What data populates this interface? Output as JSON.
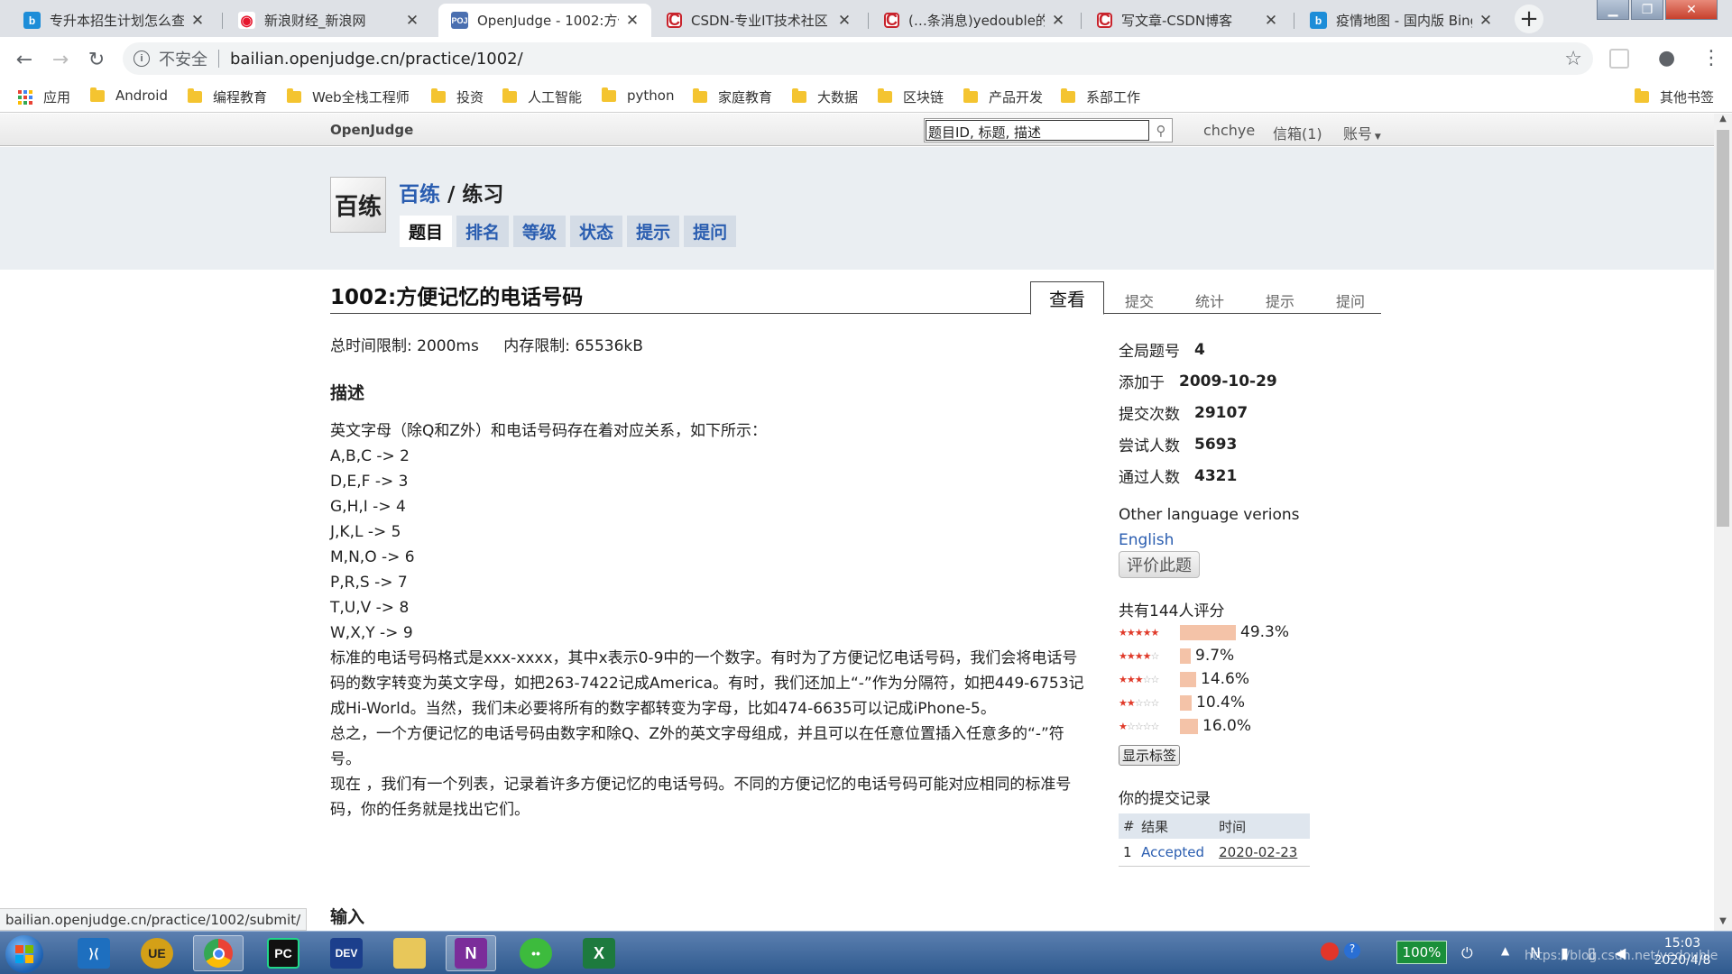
{
  "browser": {
    "tabs": [
      {
        "title": "专升本招生计划怎么查",
        "favicon": "bing-icon"
      },
      {
        "title": "新浪财经_新浪网",
        "favicon": "weibo-icon"
      },
      {
        "title": "OpenJudge - 1002:方便",
        "favicon": "poj-icon",
        "active": true
      },
      {
        "title": "CSDN-专业IT技术社区",
        "favicon": "csdn-icon"
      },
      {
        "title": "(…条消息)yedouble的",
        "favicon": "csdn-icon"
      },
      {
        "title": "写文章-CSDN博客",
        "favicon": "csdn-icon"
      },
      {
        "title": "疫情地图 - 国内版 Bing",
        "favicon": "bing-icon"
      }
    ],
    "security_label": "不安全",
    "url": "bailian.openjudge.cn/practice/1002/",
    "bookmarks": [
      "应用",
      "Android",
      "编程教育",
      "Web全栈工程师",
      "投资",
      "人工智能",
      "python",
      "家庭教育",
      "大数据",
      "区块链",
      "产品开发",
      "系部工作"
    ],
    "other_bookmarks": "其他书签",
    "status_url": "bailian.openjudge.cn/practice/1002/submit/"
  },
  "oj": {
    "brand": "OpenJudge",
    "search_value": "题目ID, 标题, 描述",
    "user": "chchye",
    "mailbox": "信箱(1)",
    "account": "账号",
    "logo_text": "百练",
    "crumb_link": "百练",
    "crumb_sep": " / ",
    "crumb_current": "练习",
    "nav": [
      "题目",
      "排名",
      "等级",
      "状态",
      "提示",
      "提问"
    ]
  },
  "problem": {
    "title": "1002:方便记忆的电话号码",
    "tabs": [
      "查看",
      "提交",
      "统计",
      "提示",
      "提问"
    ],
    "time_limit": "总时间限制: 2000ms",
    "memory_limit": "内存限制: 65536kB",
    "desc_heading": "描述",
    "desc_lines": [
      "英文字母（除Q和Z外）和电话号码存在着对应关系，如下所示：",
      "A,B,C -> 2",
      "D,E,F -> 3",
      "G,H,I -> 4",
      "J,K,L -> 5",
      "M,N,O -> 6",
      "P,R,S -> 7",
      "T,U,V -> 8",
      "W,X,Y -> 9",
      "标准的电话号码格式是xxx-xxxx，其中x表示0-9中的一个数字。有时为了方便记忆电话号码，我们会将电话号码的数字转变为英文字母，如把263-7422记成America。有时，我们还加上“-”作为分隔符，如把449-6753记成Hi-World。当然，我们未必要将所有的数字都转变为字母，比如474-6635可以记成iPhone-5。",
      "总之，一个方便记忆的电话号码由数字和除Q、Z外的英文字母组成，并且可以在任意位置插入任意多的“-”符号。",
      "现在 ，我们有一个列表，记录着许多方便记忆的电话号码。不同的方便记忆的电话号码可能对应相同的标准号码，你的任务就是找出它们。"
    ],
    "input_heading": "输入"
  },
  "side": {
    "info": [
      {
        "k": "全局题号",
        "v": "4"
      },
      {
        "k": "添加于",
        "v": "2009-10-29"
      },
      {
        "k": "提交次数",
        "v": "29107"
      },
      {
        "k": "尝试人数",
        "v": "5693"
      },
      {
        "k": "通过人数",
        "v": "4321"
      }
    ],
    "lang_heading": "Other language verions",
    "lang_link": "English",
    "rate_button": "评价此题",
    "rating_heading": "共有144人评分",
    "ratings": [
      {
        "stars": 5,
        "pct": "49.3%",
        "value": 49.3
      },
      {
        "stars": 4,
        "pct": "9.7%",
        "value": 9.7
      },
      {
        "stars": 3,
        "pct": "14.6%",
        "value": 14.6
      },
      {
        "stars": 2,
        "pct": "10.4%",
        "value": 10.4
      },
      {
        "stars": 1,
        "pct": "16.0%",
        "value": 16.0
      }
    ],
    "show_tags": "显示标签",
    "sub_heading": "你的提交记录",
    "sub_cols": [
      "#",
      "结果",
      "时间"
    ],
    "sub_rows": [
      {
        "n": "1",
        "result": "Accepted",
        "time": "2020-02-23"
      }
    ]
  },
  "taskbar": {
    "apps": [
      "vscode-icon",
      "ultraedit-icon",
      "chrome-icon",
      "pycharm-icon",
      "devcpp-icon",
      "explorer-icon",
      "onenote-icon",
      "wechat-icon",
      "excel-icon"
    ],
    "battery": "100%",
    "time": "15:03",
    "date": "2020/4/8",
    "watermark": "https://blog.csdn.net/yedouble"
  },
  "colors": {
    "link": "#2a5db0",
    "accent_bar": "#f4c3a8",
    "taskbar": "#2f5a8e"
  }
}
